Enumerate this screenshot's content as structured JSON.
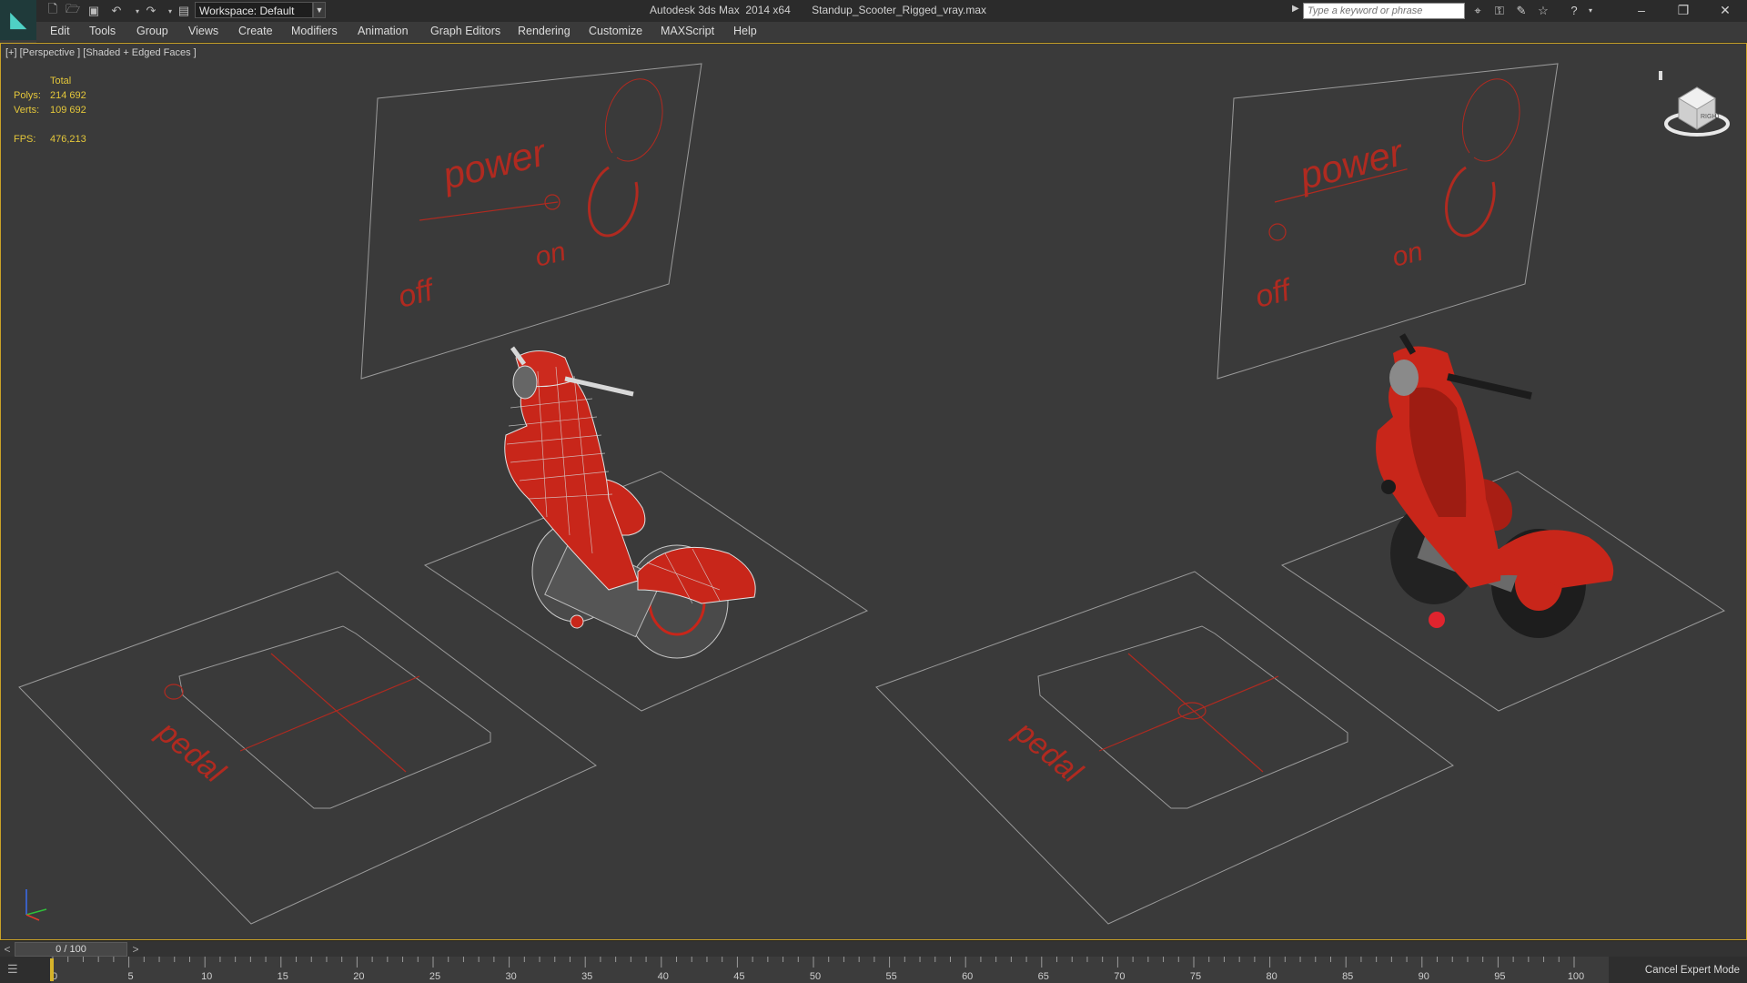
{
  "app": {
    "title": "Autodesk 3ds Max  2014 x64",
    "file": "Standup_Scooter_Rigged_vray.max",
    "workspace": "Workspace: Default"
  },
  "search": {
    "placeholder": "Type a keyword or phrase"
  },
  "menu": [
    "Edit",
    "Tools",
    "Group",
    "Views",
    "Create",
    "Modifiers",
    "Animation",
    "Graph Editors",
    "Rendering",
    "Customize",
    "MAXScript",
    "Help"
  ],
  "viewport": {
    "label": "[+] [Perspective ] [Shaded + Edged Faces ]",
    "stats": {
      "header": "Total",
      "polys_label": "Polys:",
      "polys_value": "214 692",
      "verts_label": "Verts:",
      "verts_value": "109 692",
      "fps_label": "FPS:",
      "fps_value": "476,213"
    },
    "panel_text": {
      "power": "power",
      "on": "on",
      "off": "off",
      "pedal": "pedal"
    },
    "viewcube_label": "RIGHT"
  },
  "timeline": {
    "frame": "0 / 100",
    "prev": "<",
    "next": ">",
    "ticks": [
      "0",
      "5",
      "10",
      "15",
      "20",
      "25",
      "30",
      "35",
      "40",
      "45",
      "50",
      "55",
      "60",
      "65",
      "70",
      "75",
      "80",
      "85",
      "90",
      "95",
      "100"
    ],
    "cancel_expert": "Cancel Expert Mode"
  },
  "colors": {
    "accent": "#c9a227",
    "stats": "#e4c73a",
    "scooter_red": "#c8261a",
    "wire": "#b9b9b9"
  },
  "icons": {
    "new": "new-file-icon",
    "open": "open-file-icon",
    "save": "save-icon",
    "undo": "undo-icon",
    "redo": "redo-icon",
    "project": "project-folder-icon"
  }
}
